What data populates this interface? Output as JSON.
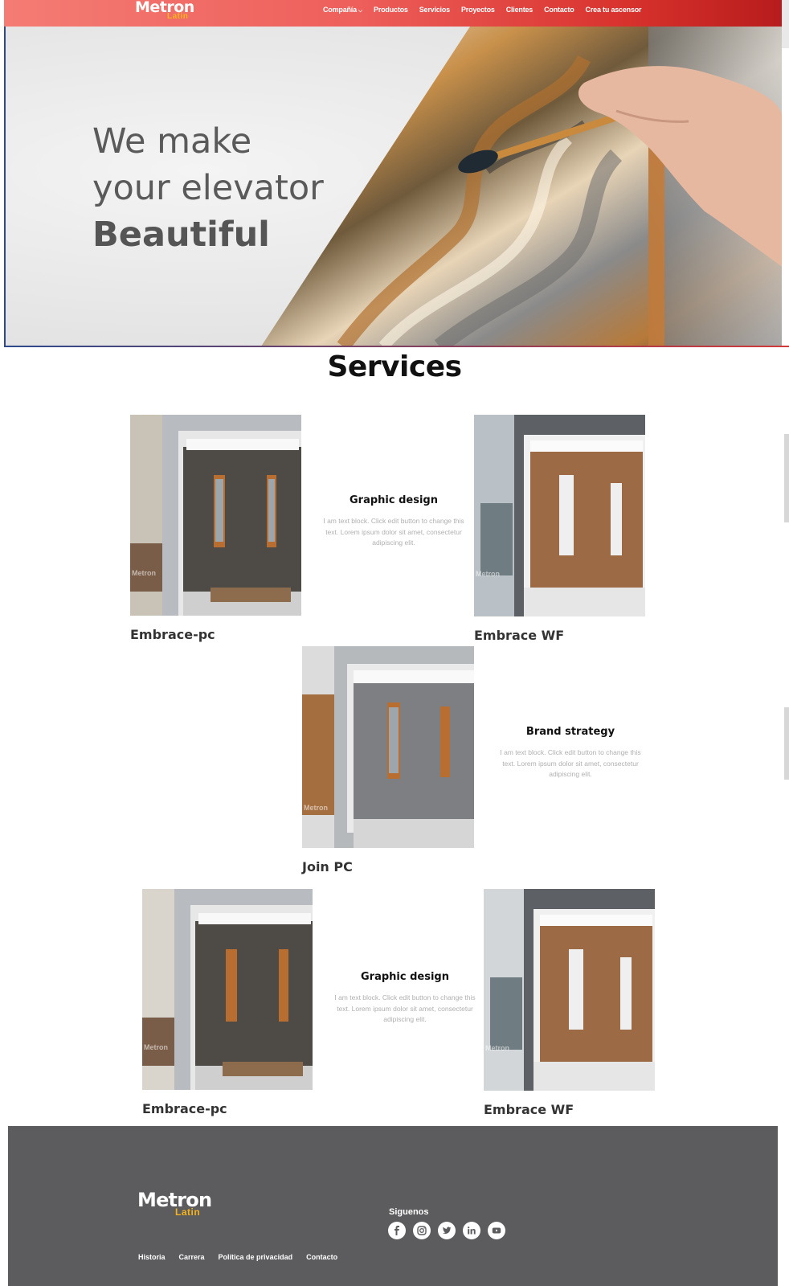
{
  "nav": {
    "logo": {
      "brand": "Metron",
      "sub": "Latin"
    },
    "items": [
      {
        "label": "Compañía",
        "has_dropdown": true
      },
      {
        "label": "Productos"
      },
      {
        "label": "Servicios"
      },
      {
        "label": "Proyectos"
      },
      {
        "label": "Clientes"
      },
      {
        "label": "Contacto"
      },
      {
        "label": "Crea tu ascensor"
      }
    ]
  },
  "hero": {
    "line1": "We make",
    "line2": "your elevator",
    "line3": "Beautiful"
  },
  "services": {
    "title": "Services",
    "cards": [
      {
        "name": "Embrace-pc"
      },
      {
        "name": "Embrace WF"
      },
      {
        "name": "Join PC"
      },
      {
        "name": "Embrace-pc"
      },
      {
        "name": "Embrace WF"
      }
    ],
    "blocks": [
      {
        "title": "Graphic design",
        "text": "I am text block. Click edit button to change this text. Lorem ipsum dolor sit amet, consectetur adipiscing elit."
      },
      {
        "title": "Brand strategy",
        "text": "I am text block. Click edit button to change this text. Lorem ipsum dolor sit amet, consectetur adipiscing elit."
      },
      {
        "title": "Graphic design",
        "text": "I am text block. Click edit button to change this text. Lorem ipsum dolor sit amet, consectetur adipiscing elit."
      }
    ],
    "watermark": "Metron"
  },
  "footer": {
    "logo": {
      "brand": "Metron",
      "sub": "Latin"
    },
    "follow_label": "Siguenos",
    "social": [
      "facebook-icon",
      "instagram-icon",
      "twitter-icon",
      "linkedin-icon",
      "youtube-icon"
    ],
    "links": [
      "Historia",
      "Carrera",
      "Política de privacidad",
      "Contacto"
    ]
  },
  "colors": {
    "nav_start": "#f47c74",
    "nav_end": "#b71c1c",
    "logo_accent": "#f6b31b",
    "footer_bg": "#5c5c5f"
  }
}
